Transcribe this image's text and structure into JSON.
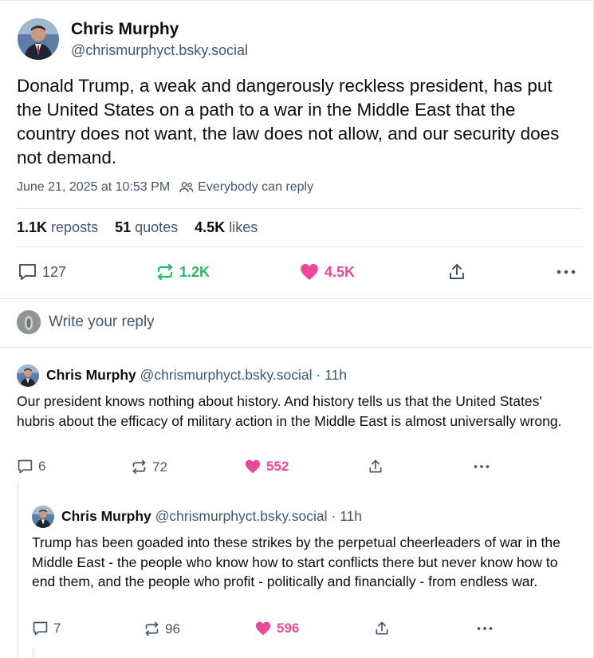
{
  "post": {
    "author_name": "Chris Murphy",
    "author_handle": "@chrismurphyct.bsky.social",
    "text": "Donald Trump, a weak and dangerously reckless president, has put the United States on a path to a war in the Middle East that the country does not want, the law does not allow, and our security does not demand.",
    "timestamp": "June 21, 2025 at 10:53 PM",
    "reply_setting": "Everybody can reply",
    "stats": {
      "reposts_count": "1.1K",
      "reposts_label": "reposts",
      "quotes_count": "51",
      "quotes_label": "quotes",
      "likes_count": "4.5K",
      "likes_label": "likes"
    },
    "actions": {
      "replies": "127",
      "reposts": "1.2K",
      "likes": "4.5K"
    }
  },
  "reply_box": {
    "placeholder": "Write your reply"
  },
  "replies": [
    {
      "author_name": "Chris Murphy",
      "author_handle": "@chrismurphyct.bsky.social",
      "time": "· 11h",
      "text": "Our president knows nothing about history. And history tells us that the United States' hubris about the efficacy of military action in the Middle East is almost universally wrong.",
      "replies": "6",
      "reposts": "72",
      "likes": "552"
    },
    {
      "author_name": "Chris Murphy",
      "author_handle": "@chrismurphyct.bsky.social",
      "time": "· 11h",
      "text": "Trump has been goaded into these strikes by the perpetual cheerleaders of war in the Middle East - the people who know how to start conflicts there but never know how to end them, and the people who profit - politically and financially - from endless war.",
      "replies": "7",
      "reposts": "96",
      "likes": "596"
    }
  ],
  "colors": {
    "repost_active": "#20bc6c",
    "like_active": "#ec4899",
    "muted": "#42576c",
    "divider": "#e3e7ec"
  }
}
